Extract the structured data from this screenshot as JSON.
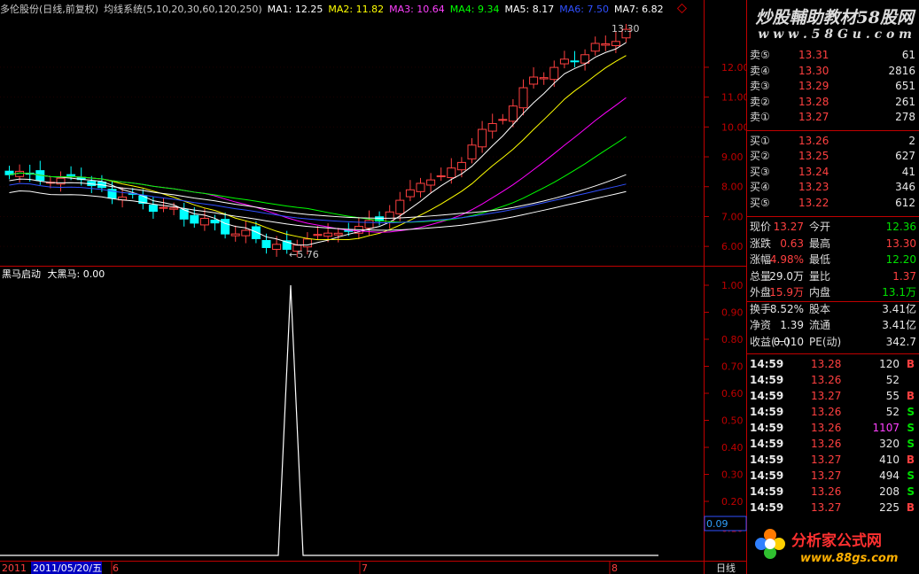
{
  "header": {
    "stock": "多伦股份(日线,前复权)",
    "system": "均线系统(5,10,20,30,60,120,250)",
    "ma1": "MA1: 12.25",
    "ma2": "MA2: 11.82",
    "ma3": "MA3: 10.64",
    "ma4": "MA4: 9.34",
    "ma5": "MA5: 8.17",
    "ma6": "MA6: 7.50",
    "ma7": "MA7: 6.82"
  },
  "main_chart": {
    "high_label": "13.30",
    "low_label": "←5.76",
    "axis_ticks": [
      "12.00",
      "11.00",
      "10.00",
      "9.00",
      "8.00",
      "7.00",
      "6.00"
    ]
  },
  "indicator": {
    "title": "黑马启动",
    "value_label": "大黑马: 0.00",
    "axis_ticks": [
      "1.00",
      "0.90",
      "0.80",
      "0.70",
      "0.60",
      "0.50",
      "0.40",
      "0.30",
      "0.20",
      "0.10"
    ],
    "cursor_value": "0.09"
  },
  "date_bar": {
    "year": "2011",
    "cursor_date": "2011/05/20/五",
    "month6": "6",
    "month7": "7",
    "month8": "8",
    "period_button": "日线"
  },
  "watermark_top": {
    "line1": "炒股輔助教材58股网",
    "line2": "w w w . 5 8 G u . c o m"
  },
  "watermark_bottom": {
    "line1": "分析家公式网",
    "line2": "www.88gs.com"
  },
  "quote": {
    "sell": [
      {
        "label": "卖⑤",
        "price": "13.31",
        "vol": "61"
      },
      {
        "label": "卖④",
        "price": "13.30",
        "vol": "2816"
      },
      {
        "label": "卖③",
        "price": "13.29",
        "vol": "651"
      },
      {
        "label": "卖②",
        "price": "13.28",
        "vol": "261"
      },
      {
        "label": "卖①",
        "price": "13.27",
        "vol": "278"
      }
    ],
    "buy": [
      {
        "label": "买①",
        "price": "13.26",
        "vol": "2"
      },
      {
        "label": "买②",
        "price": "13.25",
        "vol": "627"
      },
      {
        "label": "买③",
        "price": "13.24",
        "vol": "41"
      },
      {
        "label": "买④",
        "price": "13.23",
        "vol": "346"
      },
      {
        "label": "买⑤",
        "price": "13.22",
        "vol": "612"
      }
    ],
    "stats": [
      {
        "l1": "现价",
        "v1": "13.27",
        "c1": "up",
        "l2": "今开",
        "v2": "12.36",
        "c2": "dn"
      },
      {
        "l1": "涨跌",
        "v1": "0.63",
        "c1": "up",
        "l2": "最高",
        "v2": "13.30",
        "c2": "up"
      },
      {
        "l1": "涨幅",
        "v1": "4.98%",
        "c1": "up",
        "l2": "最低",
        "v2": "12.20",
        "c2": "dn"
      },
      {
        "l1": "总量",
        "v1": "29.0万",
        "c1": "wh",
        "l2": "量比",
        "v2": "1.37",
        "c2": "up"
      },
      {
        "l1": "外盘",
        "v1": "15.9万",
        "c1": "up",
        "l2": "内盘",
        "v2": "13.1万",
        "c2": "dn"
      },
      {
        "l1": "换手",
        "v1": "8.52%",
        "c1": "wh",
        "l2": "股本",
        "v2": "3.41亿",
        "c2": "wh"
      },
      {
        "l1": "净资",
        "v1": "1.39",
        "c1": "wh",
        "l2": "流通",
        "v2": "3.41亿",
        "c2": "wh"
      },
      {
        "l1": "收益(一)",
        "v1": "0.010",
        "c1": "wh",
        "l2": "PE(动)",
        "v2": "342.7",
        "c2": "wh"
      }
    ],
    "ticks": [
      {
        "time": "14:59",
        "price": "13.28",
        "vol": "120",
        "flag": "B"
      },
      {
        "time": "14:59",
        "price": "13.26",
        "vol": "52",
        "flag": ""
      },
      {
        "time": "14:59",
        "price": "13.27",
        "vol": "55",
        "flag": "B"
      },
      {
        "time": "14:59",
        "price": "13.26",
        "vol": "52",
        "flag": "S"
      },
      {
        "time": "14:59",
        "price": "13.26",
        "vol": "1107",
        "flag": "S"
      },
      {
        "time": "14:59",
        "price": "13.26",
        "vol": "320",
        "flag": "S"
      },
      {
        "time": "14:59",
        "price": "13.27",
        "vol": "410",
        "flag": "B"
      },
      {
        "time": "14:59",
        "price": "13.27",
        "vol": "494",
        "flag": "S"
      },
      {
        "time": "14:59",
        "price": "13.26",
        "vol": "208",
        "flag": "S"
      },
      {
        "time": "14:59",
        "price": "13.27",
        "vol": "225",
        "flag": "B"
      }
    ]
  },
  "colors": {
    "up": "#ff4040",
    "down": "#00ffff",
    "ma1": "#ffffff",
    "ma2": "#ffff00",
    "ma3": "#ff00ff",
    "ma4": "#00ff00",
    "ma5": "#ffffff",
    "ma6": "#3050ff",
    "ma7": "#ffffff",
    "frame": "#c00000"
  },
  "chart_data": {
    "type": "candlestick",
    "price_axis": {
      "min": 5.5,
      "max": 13.6,
      "ticks": [
        6,
        7,
        8,
        9,
        10,
        11,
        12
      ]
    },
    "indicator_series": {
      "name": "大黑马",
      "spike_index": 46,
      "spike_value": 1.0,
      "baseline": 0.0
    }
  }
}
